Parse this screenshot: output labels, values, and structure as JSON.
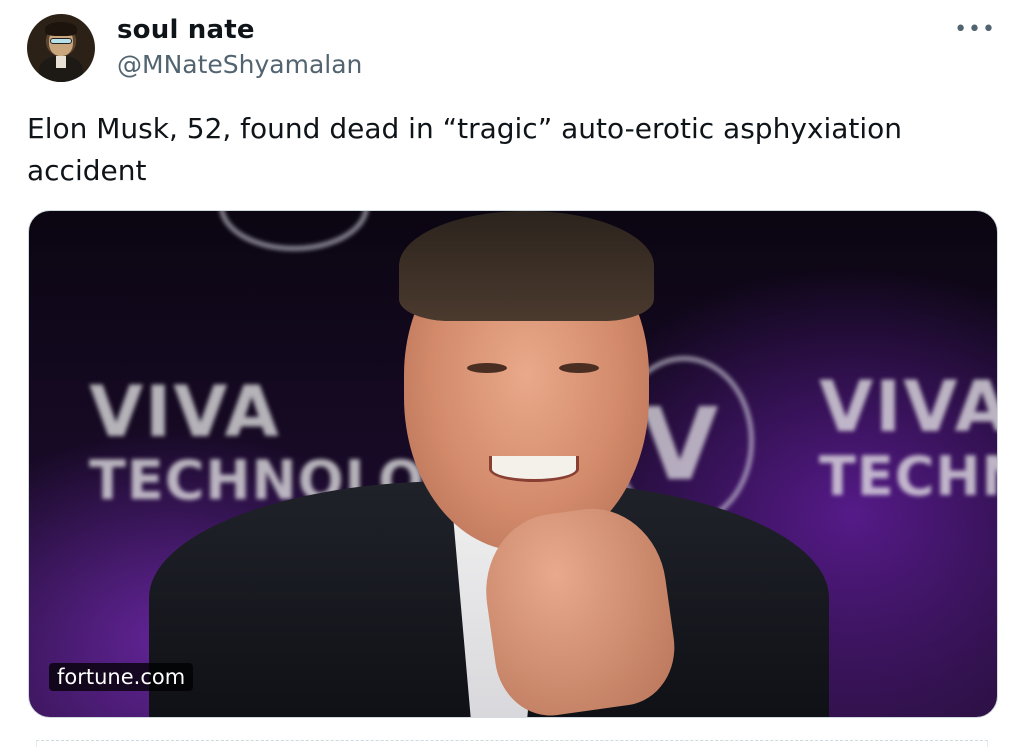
{
  "author": {
    "name": "soul nate",
    "handle": "@MNateShyamalan"
  },
  "menu": {
    "more_label": "•••"
  },
  "tweet": {
    "text": "Elon Musk, 52, found dead in “tragic” auto-erotic asphyxiation accident"
  },
  "media": {
    "background_text_left_top": "VIVA",
    "background_text_left_bottom": "TECHNOLOG",
    "background_text_right_top": "VIVA",
    "background_text_right_bottom": "TECHN",
    "background_mark": "V",
    "source_label": "fortune.com"
  },
  "colors": {
    "text_primary": "#0f1419",
    "text_secondary": "#536471",
    "border": "#cfd9de"
  },
  "icons": {
    "more": "more-horizontal-icon",
    "avatar": "user-avatar"
  }
}
